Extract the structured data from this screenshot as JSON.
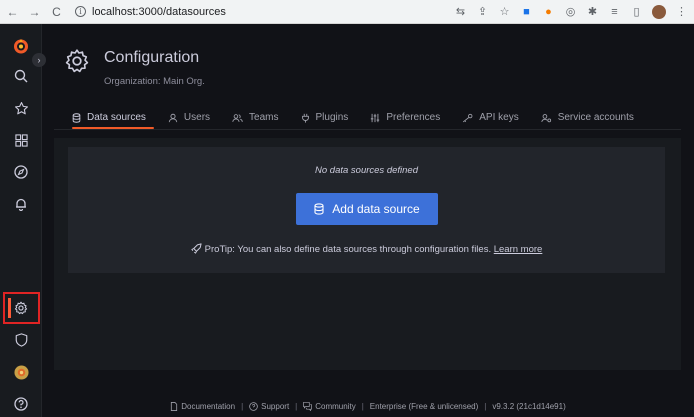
{
  "browser": {
    "back": "←",
    "forward": "→",
    "reload": "C",
    "url": "localhost:3000/datasources"
  },
  "header": {
    "title": "Configuration",
    "subtitle": "Organization: Main Org."
  },
  "tabs": [
    {
      "label": "Data sources",
      "icon": "database-icon",
      "active": true
    },
    {
      "label": "Users",
      "icon": "user-icon",
      "active": false
    },
    {
      "label": "Teams",
      "icon": "users-icon",
      "active": false
    },
    {
      "label": "Plugins",
      "icon": "plug-icon",
      "active": false
    },
    {
      "label": "Preferences",
      "icon": "sliders-icon",
      "active": false
    },
    {
      "label": "API keys",
      "icon": "key-icon",
      "active": false
    },
    {
      "label": "Service accounts",
      "icon": "user-cog-icon",
      "active": false
    }
  ],
  "empty_state": {
    "title": "No data sources defined",
    "button_label": "Add data source",
    "protip_text": "ProTip: You can also define data sources through configuration files.",
    "protip_link": "Learn more"
  },
  "footer": {
    "documentation": "Documentation",
    "support": "Support",
    "community": "Community",
    "edition": "Enterprise (Free & unlicensed)",
    "version": "v9.3.2 (21c1d14e91)"
  },
  "colors": {
    "accent": "#f05a28",
    "primary_button": "#3d71d9",
    "highlight_box": "#e02424"
  }
}
